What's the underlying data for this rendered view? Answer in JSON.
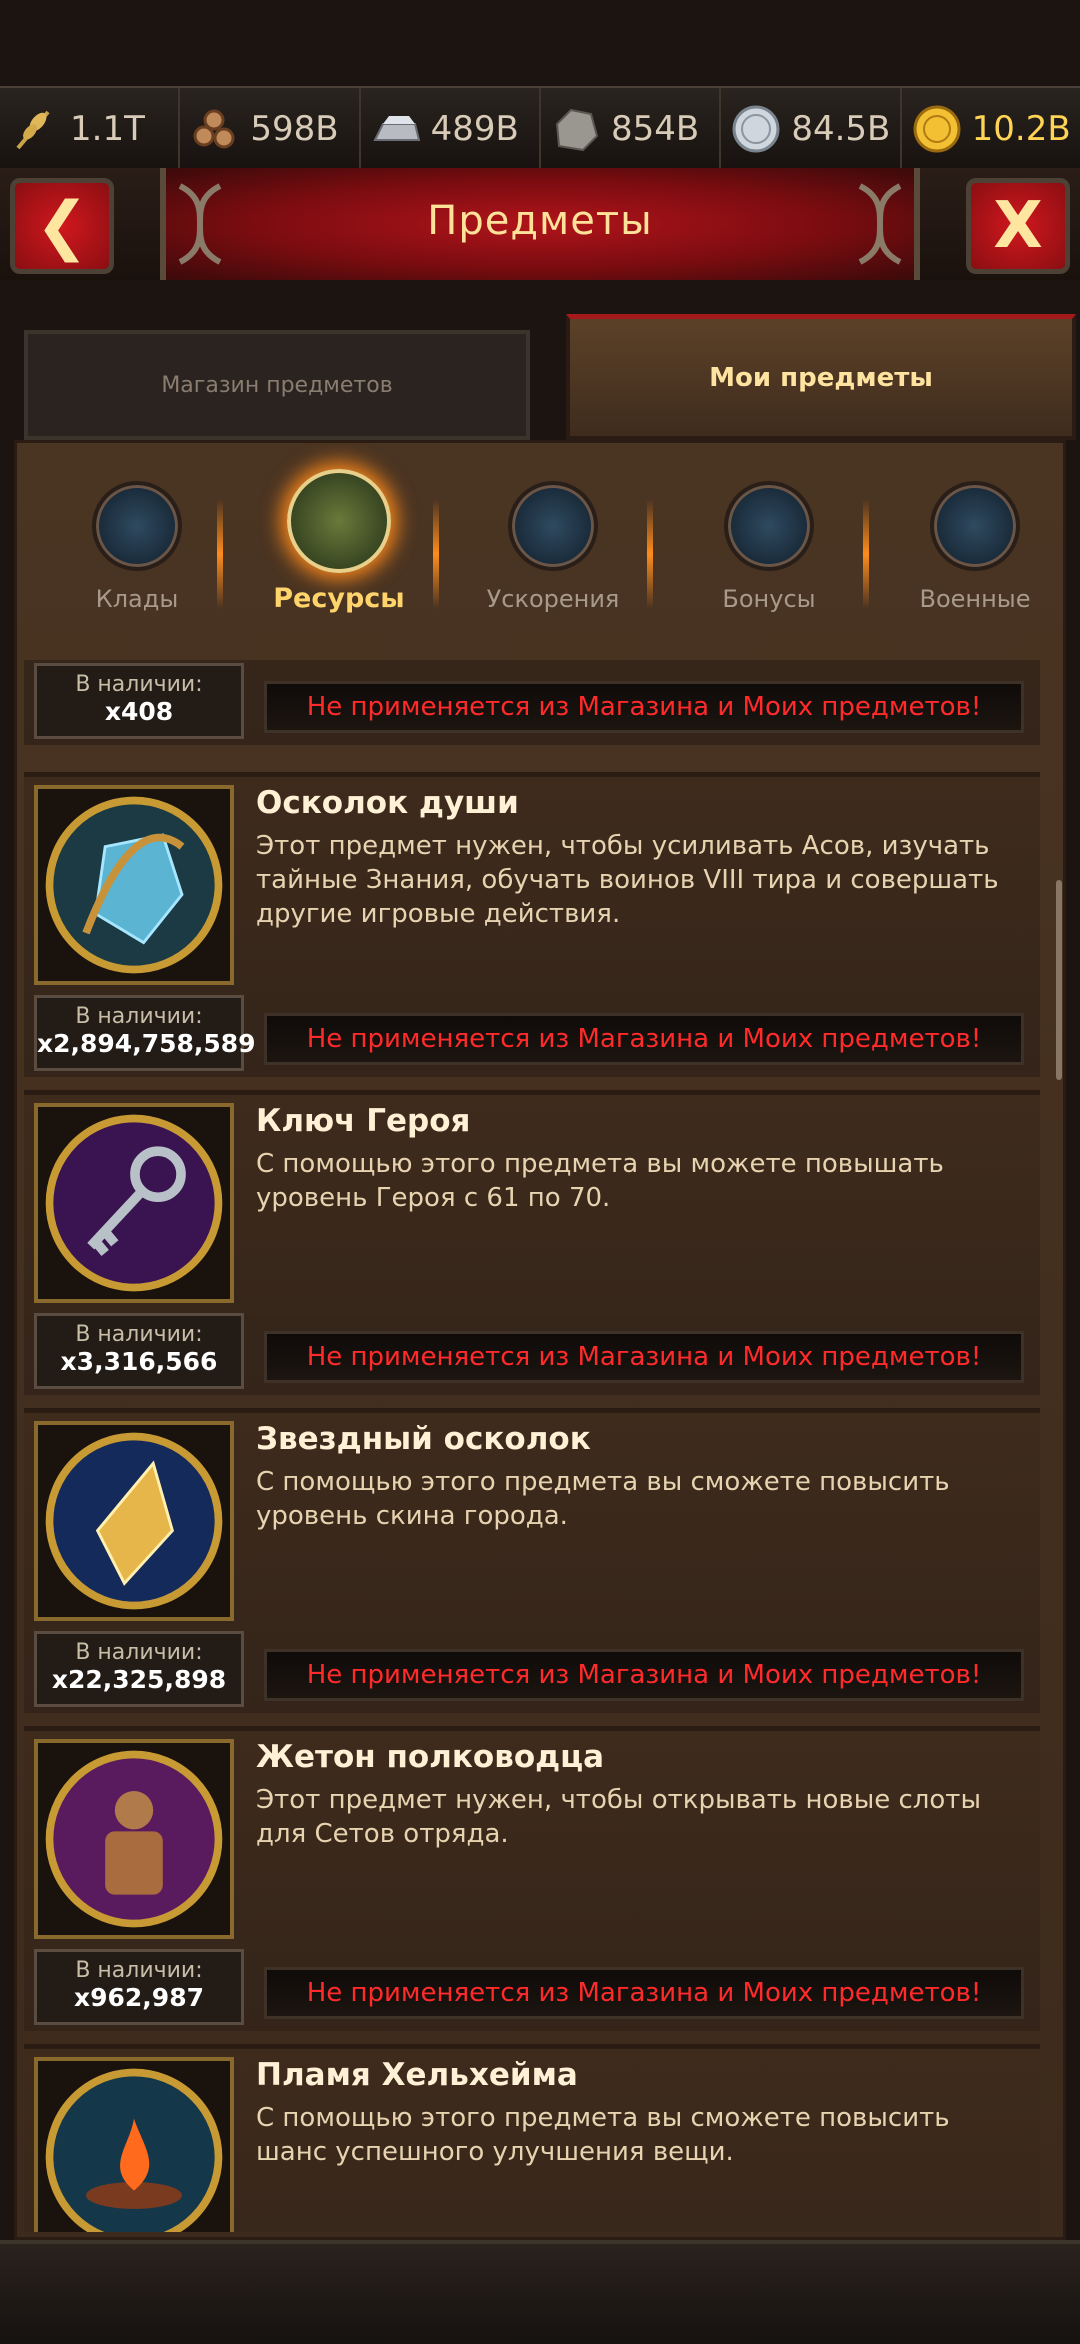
{
  "resources": [
    {
      "icon": "wheat-icon",
      "value": "1.1T"
    },
    {
      "icon": "wood-logs-icon",
      "value": "598B"
    },
    {
      "icon": "iron-ingot-icon",
      "value": "489B"
    },
    {
      "icon": "stone-icon",
      "value": "854B"
    },
    {
      "icon": "silver-coin-icon",
      "value": "84.5B"
    },
    {
      "icon": "gold-coin-icon",
      "value": "10.2B"
    }
  ],
  "header": {
    "title": "Предметы",
    "back_label": "❮",
    "close_label": "X"
  },
  "tabs": {
    "shop": "Магазин предметов",
    "mine": "Мои предметы"
  },
  "categories": [
    {
      "label": "Клады",
      "icon": "treasure-chest-icon"
    },
    {
      "label": "Ресурсы",
      "icon": "resources-bundle-icon"
    },
    {
      "label": "Ускорения",
      "icon": "hourglass-icon"
    },
    {
      "label": "Бонусы",
      "icon": "pouch-icon"
    },
    {
      "label": "Военные",
      "icon": "swords-icon"
    }
  ],
  "stock_label": "В наличии:",
  "notice": "Не применяется из Магазина и Моих предметов!",
  "items": [
    {
      "name": "",
      "desc": "",
      "count": "x408"
    },
    {
      "name": "Осколок души",
      "desc": "Этот предмет нужен, чтобы усиливать Асов, изучать тайные Знания, обучать воинов VIII тира и совершать другие игровые действия.",
      "count": "x2,894,758,589",
      "icon": "soul-shard-icon"
    },
    {
      "name": "Ключ Героя",
      "desc": "С помощью этого предмета вы можете повышать уровень Героя с 61 по 70.",
      "count": "x3,316,566",
      "icon": "hero-key-icon"
    },
    {
      "name": "Звездный осколок",
      "desc": "С помощью этого предмета вы сможете повысить уровень скина города.",
      "count": "x22,325,898",
      "icon": "star-shard-icon"
    },
    {
      "name": "Жетон полководца",
      "desc": "Этот предмет нужен, чтобы открывать новые слоты для Сетов отряда.",
      "count": "x962,987",
      "icon": "commander-token-icon"
    },
    {
      "name": "Пламя Хельхейма",
      "desc": "С помощью этого предмета вы сможете повысить шанс успешного улучшения вещи.",
      "count": "",
      "icon": "helheim-flame-icon"
    }
  ],
  "colors": {
    "accent_red": "#ff2a2a",
    "title_gold": "#ffe29a",
    "gold_value": "#ffd455"
  }
}
